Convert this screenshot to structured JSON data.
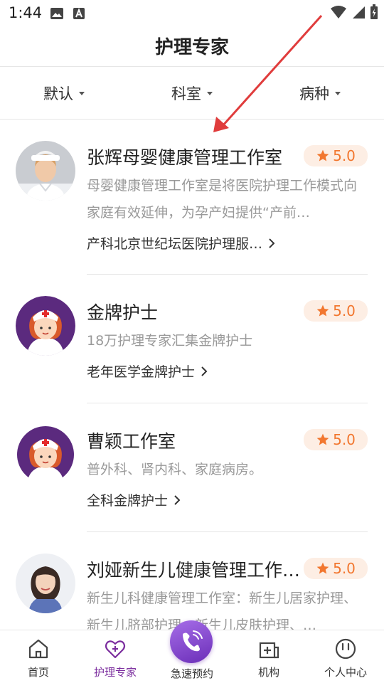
{
  "status_bar": {
    "time": "1:44"
  },
  "header": {
    "title": "护理专家"
  },
  "filters": [
    {
      "label": "默认"
    },
    {
      "label": "科室"
    },
    {
      "label": "病种"
    }
  ],
  "experts": [
    {
      "name": "张辉母婴健康管理工作室",
      "rating": "5.0",
      "description": "母婴健康管理工作室是将医院护理工作模式向家庭有效延伸，为孕产妇提供“产前…",
      "tag": "产科北京世纪坛医院护理服…",
      "avatar": "photo-woman-nurse-icon"
    },
    {
      "name": "金牌护士",
      "rating": "5.0",
      "description": "18万护理专家汇集金牌护士",
      "tag": "老年医学金牌护士",
      "avatar": "cartoon-nurse-icon"
    },
    {
      "name": "曹颖工作室",
      "rating": "5.0",
      "description": "普外科、肾内科、家庭病房。",
      "tag": "全科金牌护士",
      "avatar": "cartoon-nurse-icon"
    },
    {
      "name": "刘娅新生儿健康管理工作…",
      "rating": "5.0",
      "description": "新生儿科健康管理工作室：新生儿居家护理、新生儿脐部护理、新生儿皮肤护理、…",
      "tag": "",
      "avatar": "photo-woman-icon"
    }
  ],
  "bottom_nav": {
    "items": [
      {
        "label": "首页",
        "icon": "home-icon"
      },
      {
        "label": "护理专家",
        "icon": "nurse-heart-icon"
      },
      {
        "label": "急速预约",
        "icon": "phone-call-icon"
      },
      {
        "label": "机构",
        "icon": "clinic-icon"
      },
      {
        "label": "个人中心",
        "icon": "profile-icon"
      }
    ],
    "active": "护理专家"
  },
  "colors": {
    "accent": "#7b2d9e",
    "rating": "#f2772f",
    "rating_bg": "#fdeee4",
    "annotation_arrow": "#e03c3c"
  }
}
